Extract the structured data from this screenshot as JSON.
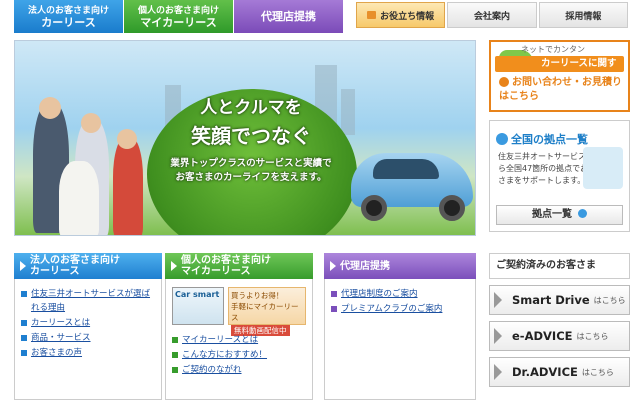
{
  "top_nav": [
    {
      "small": "法人のお客さま向け",
      "big": "カーリース"
    },
    {
      "small": "個人のお客さま向け",
      "big": "マイカーリース"
    },
    {
      "big": "代理店提携"
    }
  ],
  "sub_nav": [
    "お役立ち情報",
    "会社案内",
    "採用情報"
  ],
  "hero": {
    "line1": "人とクルマを",
    "line2": "笑顔でつなぐ",
    "line3": "業界トップクラスのサービスと実績で",
    "line4": "お客さまのカーライフを支えます。"
  },
  "cta": {
    "tag": "ネットでカンタン",
    "bar": "カーリースに関する",
    "line1": "お問い合わせ・お見積り",
    "line2": "はこちら"
  },
  "locations": {
    "title": "全国の拠点一覧",
    "text": "住友三井オートサービスなら全国47箇所の拠点でお客さまをサポートします。",
    "button": "拠点一覧"
  },
  "col_corporate": {
    "small": "法人のお客さま向け",
    "big": "カーリース",
    "links": [
      "住友三井オートサービスが選ばれる理由",
      "カーリースとは",
      "商品・サービス",
      "お客さまの声"
    ]
  },
  "col_personal": {
    "small": "個人のお客さま向け",
    "big": "マイカーリース",
    "banner_brand": "Car smart",
    "banner_l1": "買うよりお得！",
    "banner_l2": "手軽にマイカーリース",
    "banner_badge": "無料動画配信中",
    "links": [
      "マイカーリースとは",
      "こんな方におすすめ！",
      "ご契約のながれ"
    ]
  },
  "col_agency": {
    "title": "代理店提携",
    "links": [
      "代理店制度のご案内",
      "プレミアムクラブのご案内"
    ]
  },
  "contract": {
    "title": "ご契約済みのお客さま",
    "items": [
      {
        "name": "Smart Drive",
        "suffix": "はこちら"
      },
      {
        "name": "e-ADVICE",
        "suffix": "はこちら"
      },
      {
        "name": "Dr.ADVICE",
        "suffix": "はこちら"
      }
    ]
  }
}
